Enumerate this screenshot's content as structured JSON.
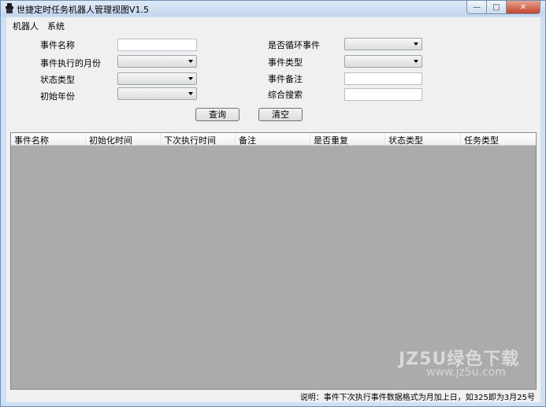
{
  "window": {
    "title": "世捷定时任务机器人管理视图V1.5",
    "buttons": {
      "minimize": "—",
      "maximize": "□",
      "close": "✕"
    }
  },
  "menu": {
    "items": [
      "机器人",
      "系统"
    ]
  },
  "form": {
    "event_name_label": "事件名称",
    "event_name_value": "",
    "month_label": "事件执行的月份",
    "month_value": "",
    "status_label": "状态类型",
    "status_value": "",
    "year_label": "初始年份",
    "year_value": "",
    "loop_label": "是否循环事件",
    "loop_value": "",
    "event_type_label": "事件类型",
    "event_type_value": "",
    "remark_label": "事件备注",
    "remark_value": "",
    "search_label": "综合搜索",
    "search_value": ""
  },
  "actions": {
    "query": "查询",
    "clear": "清空"
  },
  "table": {
    "columns": [
      "事件名称",
      "初始化时间",
      "下次执行时间",
      "备注",
      "是否重复",
      "状态类型",
      "任务类型"
    ],
    "rows": []
  },
  "footer": {
    "note": "说明：事件下次执行事件数据格式为月加上日，如325即为3月25号"
  },
  "watermark": {
    "main": "JZ5U绿色下载",
    "sub": "www.jz5u.com"
  },
  "colors": {
    "grid_background": "#ababab",
    "window_frame": "#cfe0f3",
    "close_button": "#c2452d"
  }
}
